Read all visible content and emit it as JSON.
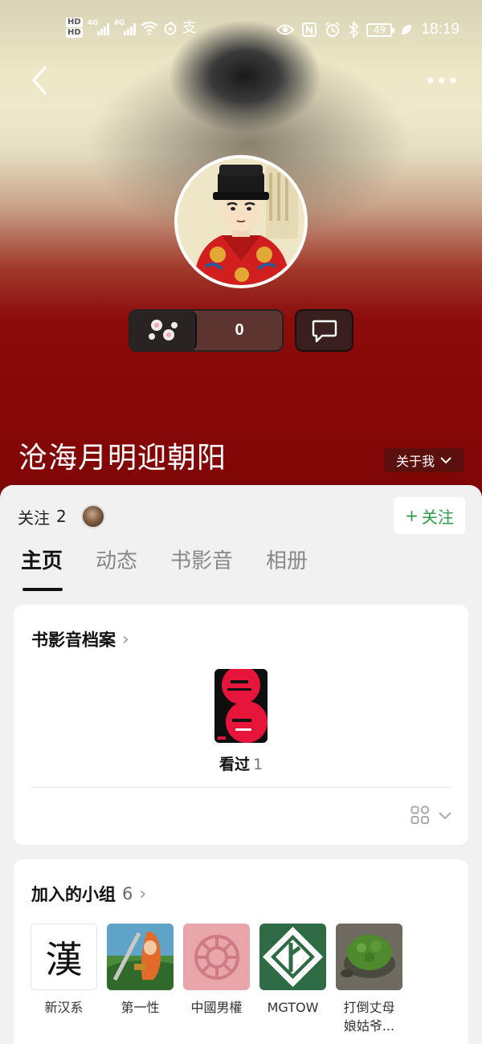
{
  "status_bar": {
    "hd1": "HD",
    "hd2": "HD",
    "net1": "4G",
    "net2": "4G",
    "pay_icon": "支",
    "battery": "49",
    "time": "18:19",
    "icons": [
      "eye-icon",
      "nfc-icon",
      "alarm-icon",
      "bluetooth-icon",
      "leaf-icon"
    ]
  },
  "profile": {
    "username": "沧海月明迎朝阳",
    "about_label": "关于我",
    "paw_count": "0",
    "follow_label": "关注",
    "follow_count": "2",
    "follow_button": "关注"
  },
  "tabs": [
    {
      "label": "主页",
      "active": true
    },
    {
      "label": "动态",
      "active": false
    },
    {
      "label": "书影音",
      "active": false
    },
    {
      "label": "相册",
      "active": false
    }
  ],
  "archive": {
    "title": "书影音档案",
    "watched_label": "看过",
    "watched_count": "1"
  },
  "groups_section": {
    "title": "加入的小组",
    "count": "6",
    "items": [
      {
        "name": "新汉系",
        "glyph": "漢"
      },
      {
        "name": "第一性"
      },
      {
        "name": "中國男權"
      },
      {
        "name": "MGTOW"
      },
      {
        "name": "打倒丈母\n娘姑爷..."
      }
    ]
  },
  "colors": {
    "hero_red": "#870707",
    "follow_green": "#2e9a48",
    "mgtow_green": "#2f6b44"
  }
}
